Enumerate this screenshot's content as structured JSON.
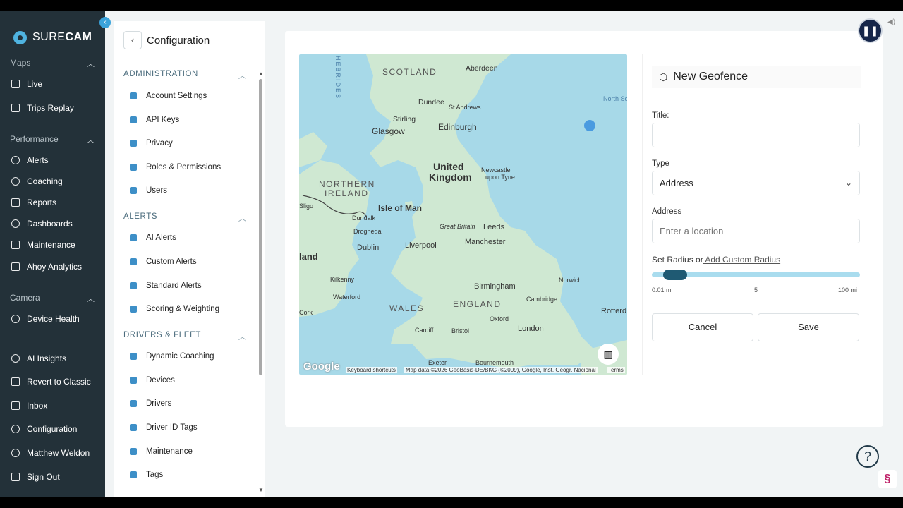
{
  "app": {
    "brand": "SURECAM",
    "brand_a": "SURE",
    "brand_b": "CAM"
  },
  "nav": {
    "sections": [
      {
        "label": "Maps"
      },
      {
        "label": "Performance"
      },
      {
        "label": "Camera"
      }
    ],
    "items": [
      {
        "label": "Live",
        "icon": "truck-icon"
      },
      {
        "label": "Trips Replay",
        "icon": "video-icon"
      },
      {
        "label": "Alerts",
        "icon": "bell-icon"
      },
      {
        "label": "Coaching",
        "icon": "coaching-icon"
      },
      {
        "label": "Reports",
        "icon": "document-icon"
      },
      {
        "label": "Dashboards",
        "icon": "dashboard-icon"
      },
      {
        "label": "Maintenance",
        "icon": "wrench-icon"
      },
      {
        "label": "Ahoy Analytics",
        "icon": "chart-icon"
      },
      {
        "label": "Device Health",
        "icon": "heart-icon"
      },
      {
        "label": "AI Insights",
        "icon": "sparkle-icon"
      },
      {
        "label": "Revert to Classic",
        "icon": "tv-icon"
      },
      {
        "label": "Inbox",
        "icon": "inbox-icon"
      },
      {
        "label": "Configuration",
        "icon": "gear-icon"
      },
      {
        "label": "Matthew Weldon",
        "icon": "user-icon"
      },
      {
        "label": "Sign Out",
        "icon": "signout-icon"
      }
    ]
  },
  "config": {
    "title": "Configuration",
    "sections": [
      {
        "label": "ADMINISTRATION",
        "items": [
          "Account Settings",
          "API Keys",
          "Privacy",
          "Roles & Permissions",
          "Users"
        ]
      },
      {
        "label": "ALERTS",
        "items": [
          "AI Alerts",
          "Custom Alerts",
          "Standard Alerts",
          "Scoring & Weighting"
        ]
      },
      {
        "label": "DRIVERS & FLEET",
        "items": [
          "Dynamic Coaching",
          "Devices",
          "Drivers",
          "Driver ID Tags",
          "Maintenance",
          "Tags"
        ]
      }
    ]
  },
  "map": {
    "labels": {
      "scotland": "SCOTLAND",
      "aberdeen": "Aberdeen",
      "hebrides": "HEBRIDES",
      "dundee": "Dundee",
      "st_andrews": "St Andrews",
      "stirling": "Stirling",
      "glasgow": "Glasgow",
      "edinburgh": "Edinburgh",
      "north_sea": "North Se",
      "uk": "United",
      "uk2": "Kingdom",
      "newcastle": "Newcastle",
      "newcastle2": "upon Tyne",
      "northern": "NORTHERN",
      "ireland": "IRELAND",
      "isle_of_man": "Isle of Man",
      "sligo": "Sligo",
      "dundalk": "Dundalk",
      "drogheda": "Drogheda",
      "dublin": "Dublin",
      "great_britain": "Great Britain",
      "leeds": "Leeds",
      "liverpool": "Liverpool",
      "manchester": "Manchester",
      "land": "land",
      "kilkenny": "Kilkenny",
      "birmingham": "Birmingham",
      "norwich": "Norwich",
      "waterford": "Waterford",
      "cambridge": "Cambridge",
      "wales": "WALES",
      "england": "ENGLAND",
      "cork": "Cork",
      "oxford": "Oxford",
      "rotterdam": "Rotterd",
      "cardiff": "Cardiff",
      "bristol": "Bristol",
      "london": "London",
      "exeter": "Exeter",
      "bournemouth": "Bournemouth"
    },
    "footer": {
      "google": "Google",
      "shortcuts": "Keyboard shortcuts",
      "attribution": "Map data ©2026 GeoBasis-DE/BKG (©2009), Google, Inst. Geogr. Nacional",
      "terms": "Terms"
    }
  },
  "form": {
    "heading": "New Geofence",
    "title_label": "Title:",
    "title_value": "",
    "type_label": "Type",
    "type_value": "Address",
    "address_label": "Address",
    "address_placeholder": "Enter a location",
    "radius_text": "Set Radius or",
    "radius_link": " Add Custom Radius",
    "slider": {
      "min_label": "0.01 mi",
      "mid_label": "5",
      "max_label": "100 mi",
      "value": 0.01
    },
    "cancel": "Cancel",
    "save": "Save"
  },
  "colors": {
    "nav_bg": "#233139",
    "accent": "#3aa3db",
    "slider_thumb": "#1f5a73",
    "map_water": "#a7d9e8",
    "map_land": "#cfe8d2"
  }
}
